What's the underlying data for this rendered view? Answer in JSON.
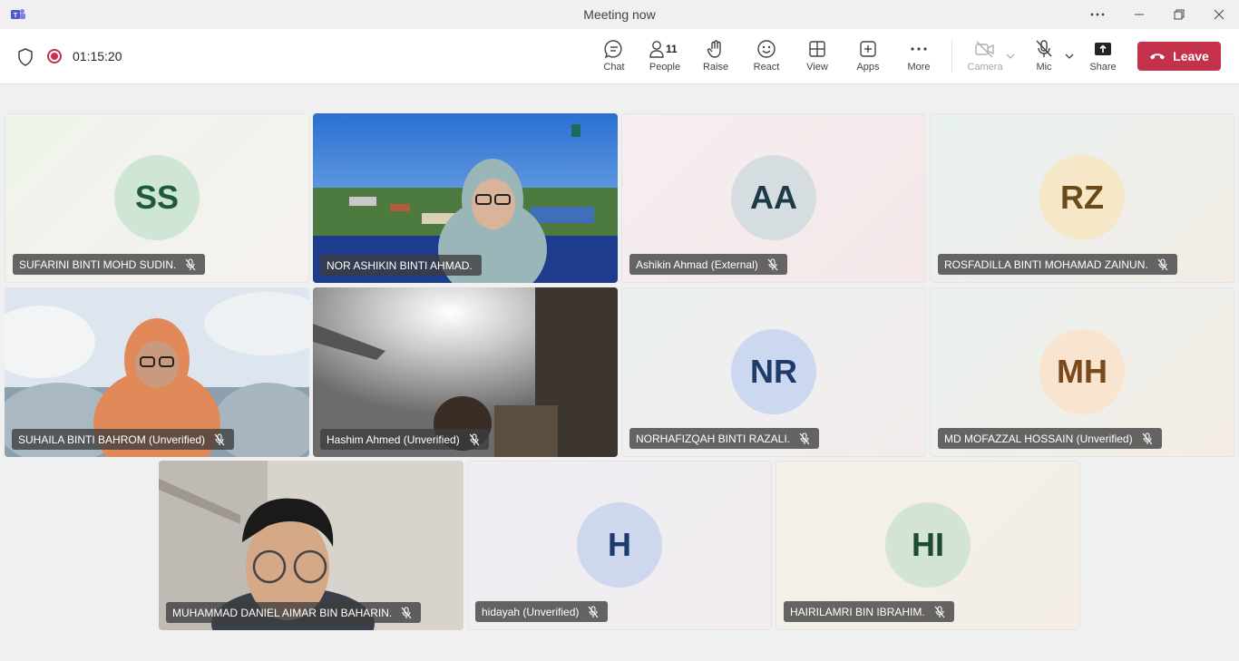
{
  "window": {
    "title": "Meeting now"
  },
  "toolbar": {
    "timer": "01:15:20",
    "chat_label": "Chat",
    "people_label": "People",
    "people_count": "11",
    "raise_label": "Raise",
    "react_label": "React",
    "view_label": "View",
    "apps_label": "Apps",
    "more_label": "More",
    "camera_label": "Camera",
    "mic_label": "Mic",
    "share_label": "Share",
    "leave_label": "Leave"
  },
  "colors": {
    "leave": "#c4314b",
    "record": "#c4314b"
  },
  "participants": [
    {
      "name": "SUFARINI BINTI MOHD SUDIN.",
      "initials": "SS",
      "muted": true,
      "video": false
    },
    {
      "name": "NOR ASHIKIN BINTI AHMAD.",
      "initials": "",
      "muted": false,
      "video": true
    },
    {
      "name": "Ashikin Ahmad (External)",
      "initials": "AA",
      "muted": true,
      "video": false
    },
    {
      "name": "ROSFADILLA BINTI MOHAMAD ZAINUN.",
      "initials": "RZ",
      "muted": true,
      "video": false
    },
    {
      "name": "SUHAILA BINTI BAHROM (Unverified)",
      "initials": "",
      "muted": true,
      "video": true
    },
    {
      "name": "Hashim Ahmed (Unverified)",
      "initials": "",
      "muted": true,
      "video": true
    },
    {
      "name": "NORHAFIZQAH BINTI RAZALI.",
      "initials": "NR",
      "muted": true,
      "video": false
    },
    {
      "name": "MD MOFAZZAL HOSSAIN (Unverified)",
      "initials": "MH",
      "muted": true,
      "video": false
    },
    {
      "name": "MUHAMMAD DANIEL AIMAR BIN BAHARIN.",
      "initials": "",
      "muted": true,
      "video": true
    },
    {
      "name": "hidayah (Unverified)",
      "initials": "H",
      "muted": true,
      "video": false
    },
    {
      "name": "HAIRILAMRI BIN IBRAHIM.",
      "initials": "HI",
      "muted": true,
      "video": false
    }
  ]
}
